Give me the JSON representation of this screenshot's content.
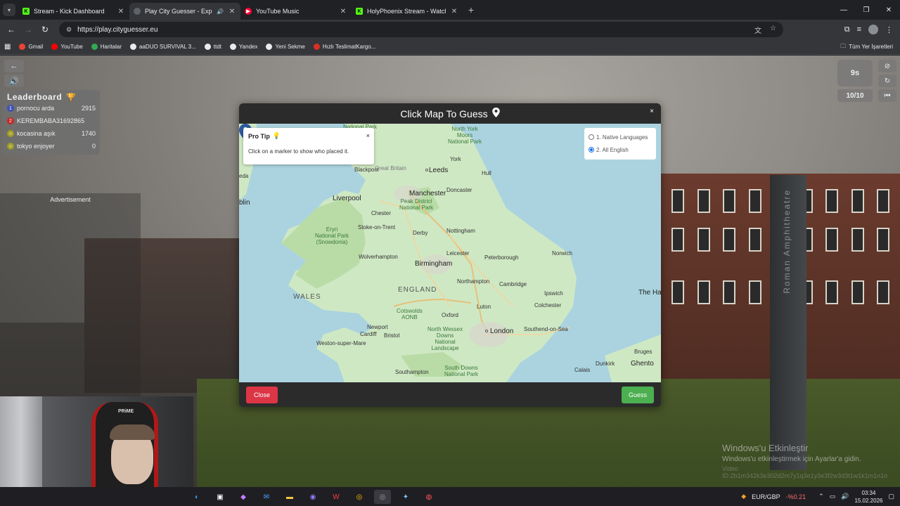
{
  "browser": {
    "tabs": [
      {
        "title": "Stream - Kick Dashboard",
        "favicon": "kick-icon",
        "active": false
      },
      {
        "title": "Play City Guesser - Explore",
        "favicon": "globe-icon",
        "active": true
      },
      {
        "title": "YouTube Music",
        "favicon": "youtube-music-icon",
        "active": false
      },
      {
        "title": "HolyPhoenix Stream - Watch Li",
        "favicon": "kick-icon",
        "active": false
      }
    ],
    "url": "https://play.cityguesser.eu",
    "bookmarks": [
      "Gmail",
      "YouTube",
      "Haritalar",
      "aaDUO SURVIVAL 3...",
      "ttdt",
      "Yandex",
      "Yeni Sekme",
      "Hızlı TeslimatKargo..."
    ],
    "all_bookmarks_label": "Tüm Yer İşaretleri"
  },
  "game": {
    "timer": "9s",
    "round": "10/10",
    "leaderboard": {
      "title": "Leaderboard",
      "players": [
        {
          "rank": "1",
          "name": "pornocu arda",
          "score": "2915",
          "color": "#3f51b5"
        },
        {
          "rank": "2",
          "name": "KEREMBABA31692865",
          "score": "",
          "color": "#c62828"
        },
        {
          "rank": "",
          "name": "kocasina aşık",
          "score": "1740",
          "color": "#9e9d24"
        },
        {
          "rank": "",
          "name": "tokyo enjoyer",
          "score": "0",
          "color": "#9e9d24"
        }
      ]
    },
    "advertisement_label": "Advertisement",
    "monolith_text": "Roman Amphitheatre"
  },
  "modal": {
    "title": "Click Map To Guess",
    "protip": {
      "title": "Pro Tip",
      "body": "Click on a marker to show who placed it.",
      "close": "×"
    },
    "language": {
      "option1": "1. Native Languages",
      "option2": "2. All English",
      "selected": 2
    },
    "close_label": "Close",
    "guess_label": "Guess",
    "close_x": "×",
    "map_labels": {
      "national_park_top": "National Park",
      "north_york_moors": "North York\nMoors\nNational Park",
      "york": "York",
      "leeds": "Leeds",
      "hull": "Hull",
      "blackpool": "Blackpool",
      "great_britain": "Great Britain",
      "liverpool": "Liverpool",
      "manchester": "Manchester",
      "doncaster": "Doncaster",
      "peak_district": "Peak District\nNational Park",
      "chester": "Chester",
      "stoke": "Stoke-on-Trent",
      "derby": "Derby",
      "nottingham": "Nottingham",
      "eryri": "Eryri\nNational Park\n(Snowdonia)",
      "wolverhampton": "Wolverhampton",
      "birmingham": "Birmingham",
      "leicester": "Leicester",
      "peterborough": "Peterborough",
      "norwich": "Norwich",
      "england": "ENGLAND",
      "wales": "WALES",
      "northampton": "Northampton",
      "cambridge": "Cambridge",
      "ipswich": "Ipswich",
      "cotswolds": "Cotswolds\nAONB",
      "oxford": "Oxford",
      "luton": "Luton",
      "colchester": "Colchester",
      "newport": "Newport",
      "cardiff": "Cardiff",
      "bristol": "Bristol",
      "north_wessex": "North Wessex\nDowns\nNational\nLandscape",
      "london": "London",
      "southend": "Southend-on-Sea",
      "weston": "Weston-super-Mare",
      "southampton": "Southampton",
      "south_downs": "South Downs\nNational Park",
      "the_hague": "The Ha",
      "bruges": "Bruges",
      "ghent": "Ghento",
      "dunkirk": "Dunkirk",
      "calais": "Calais",
      "dublin_frag": "blin",
      "ed_frag": "eda"
    }
  },
  "desktop": {
    "watermark_title": "Windows'u Etkinleştir",
    "watermark_sub": "Windows'u etkinleştirmek için Ayarlar'a gidin.",
    "watermark_id": "Video ID:2b1m342k3e302d2m7y1q3e1y3e3f2w3d3t1w1k1m1n1o",
    "currency": "EUR/GBP",
    "currency_change": "-%0.21",
    "time": "03:34",
    "date": "15.02.2026"
  },
  "webcam": {
    "chair_brand": "PRiME"
  }
}
